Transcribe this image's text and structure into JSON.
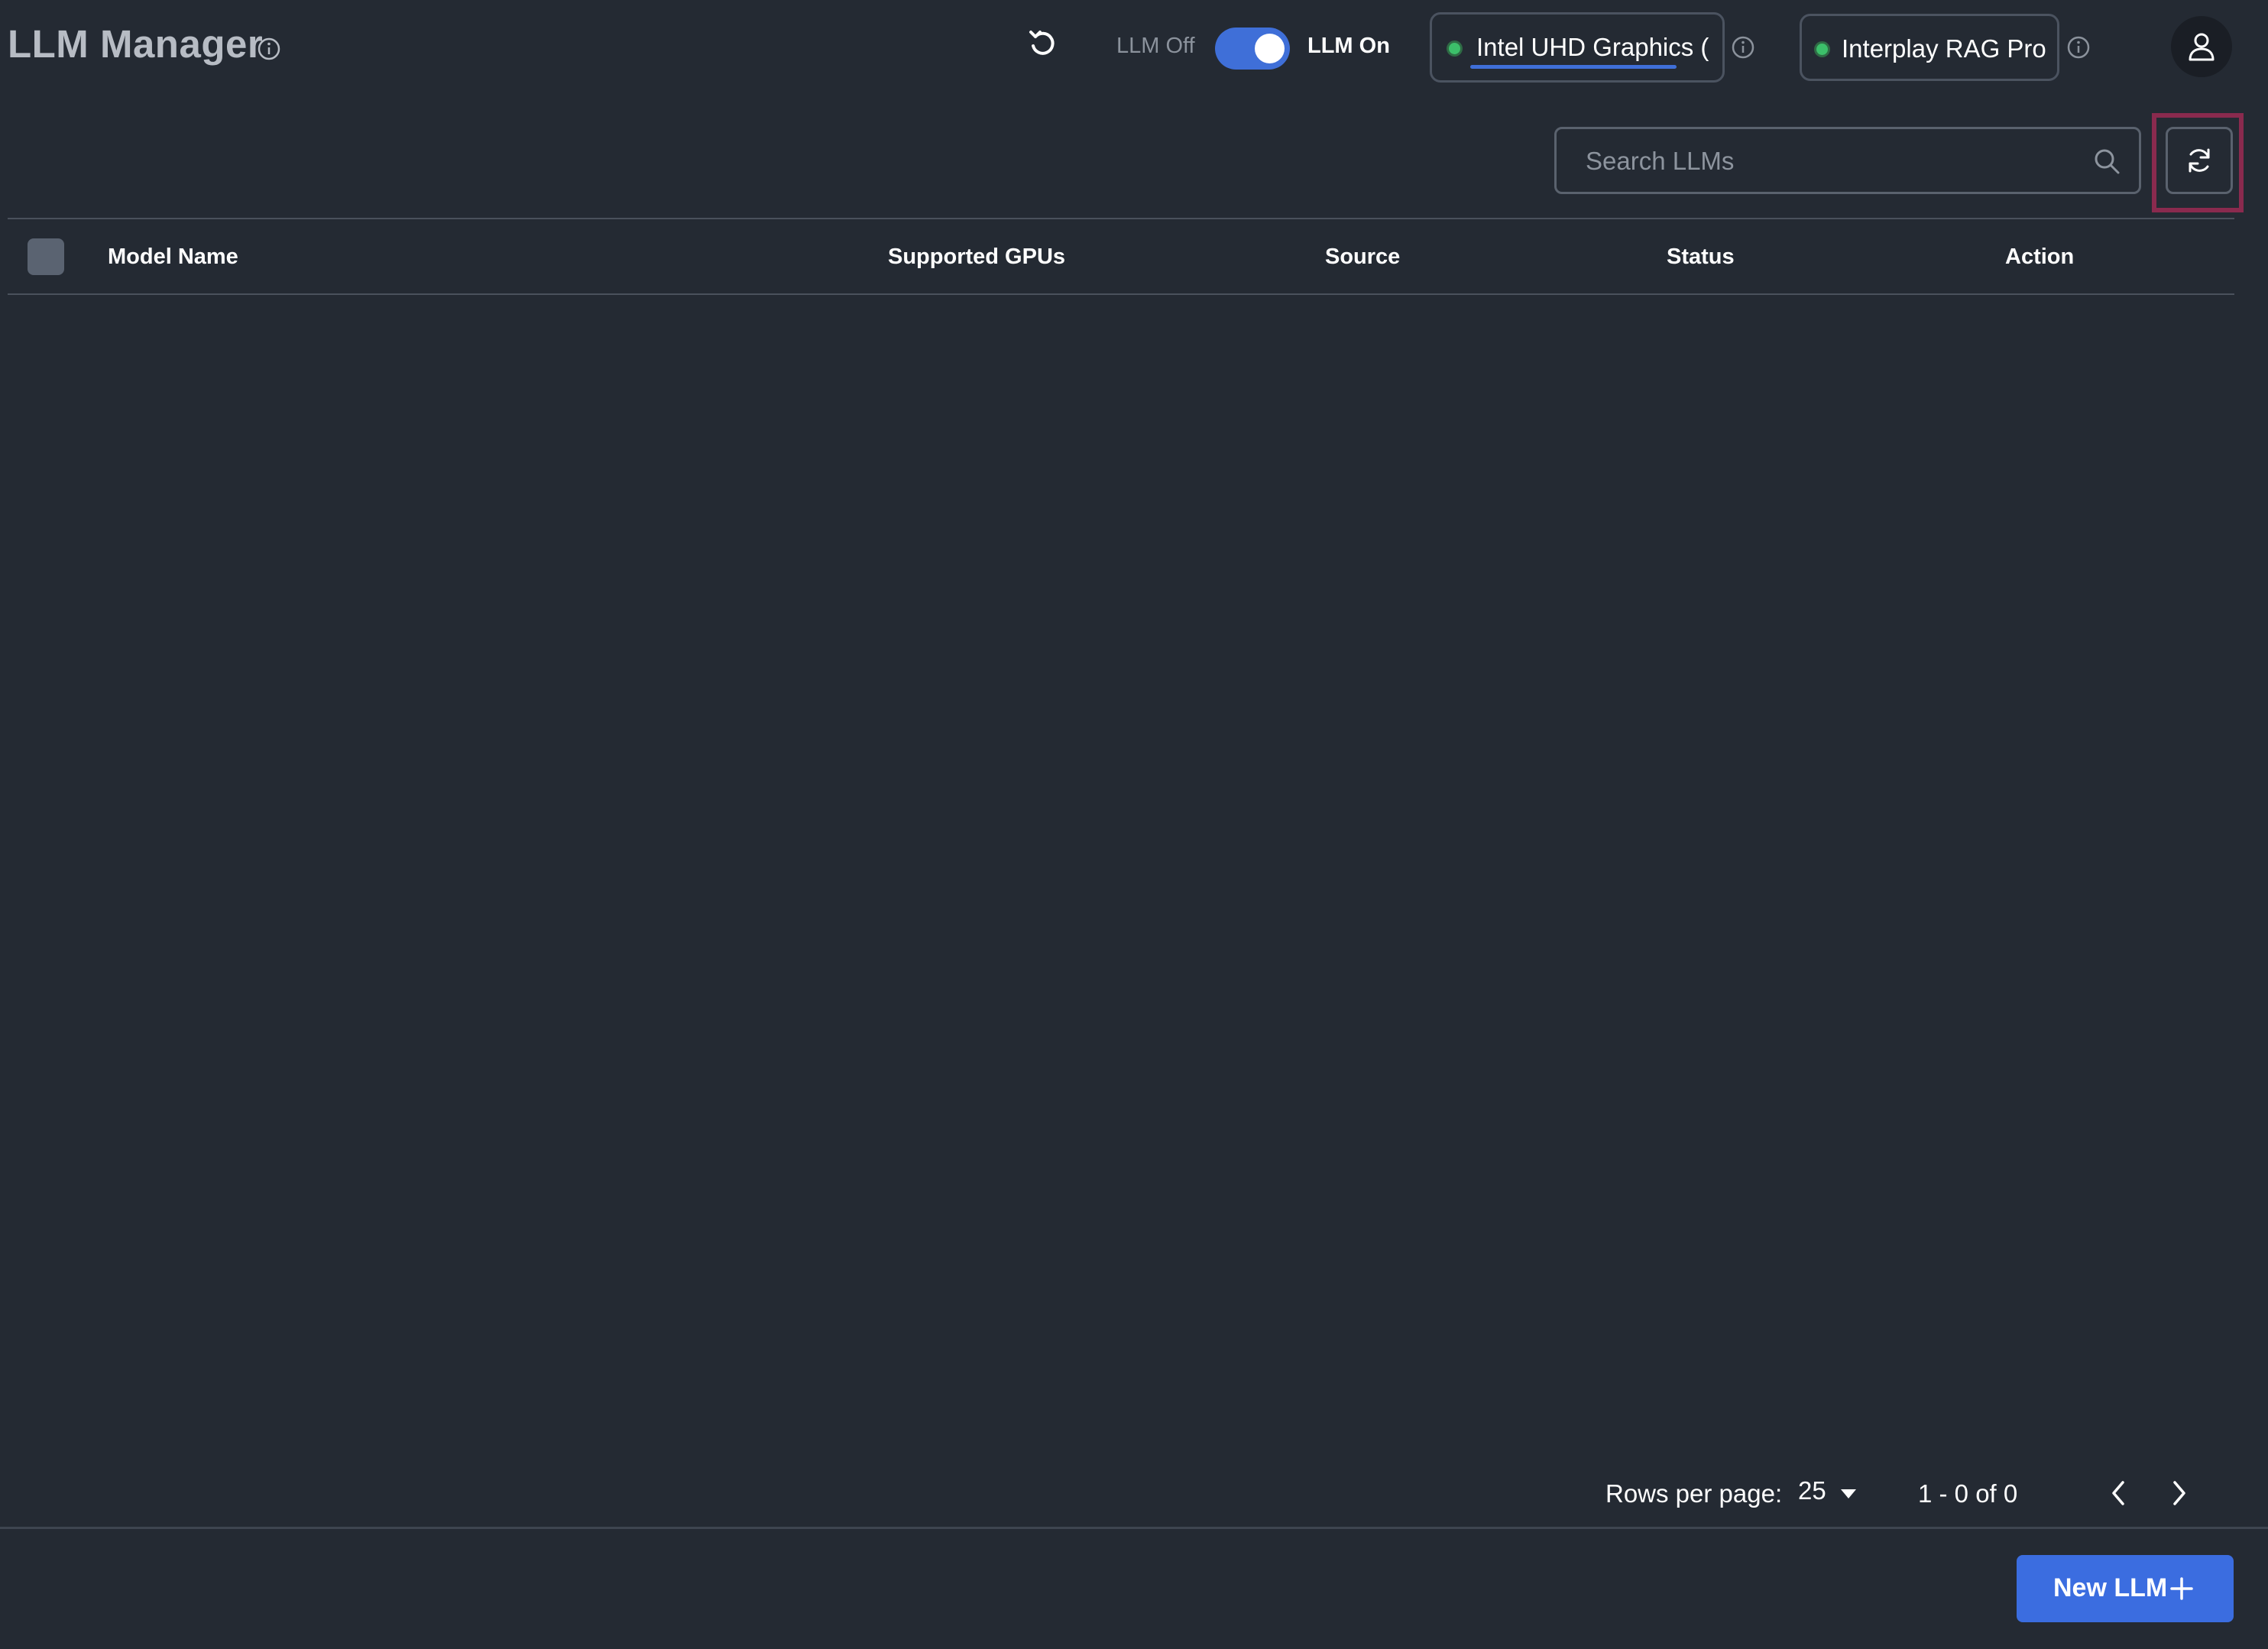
{
  "header": {
    "title": "LLM Manager",
    "llm_toggle": {
      "off_label": "LLM Off",
      "on_label": "LLM On",
      "state": "on"
    },
    "gpu_chip": {
      "label": "Intel UHD Graphics (",
      "status": "online"
    },
    "rag_chip": {
      "label": "Interplay RAG Pro",
      "status": "online"
    }
  },
  "toolbar": {
    "search_placeholder": "Search LLMs",
    "search_value": ""
  },
  "table": {
    "columns": [
      "Model Name",
      "Supported GPUs",
      "Source",
      "Status",
      "Action"
    ],
    "rows": []
  },
  "pagination": {
    "rows_per_page_label": "Rows per page:",
    "rows_per_page": "25",
    "range": "1 - 0 of 0"
  },
  "footer": {
    "new_button_label": "New LLM"
  },
  "colors": {
    "background": "#242a33",
    "accent": "#3b6de0",
    "status_online": "#3cbf6a",
    "highlight": "#8a2a4e"
  },
  "icons": [
    "info-icon",
    "undo-icon",
    "user-icon",
    "search-icon",
    "refresh-icon",
    "chevron-left-icon",
    "chevron-right-icon",
    "caret-down-icon",
    "plus-icon"
  ]
}
